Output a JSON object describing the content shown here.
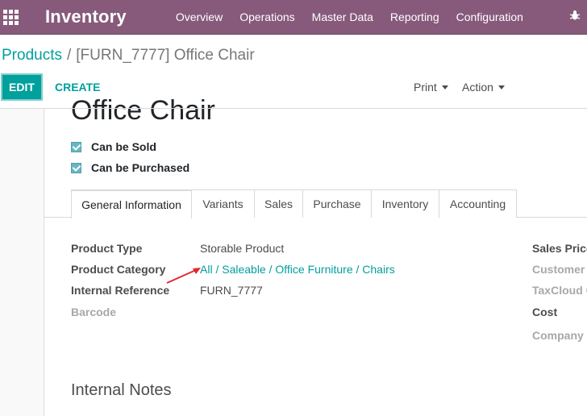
{
  "navbar": {
    "app_title": "Inventory",
    "menu": [
      "Overview",
      "Operations",
      "Master Data",
      "Reporting",
      "Configuration"
    ],
    "color": "#875a7b"
  },
  "breadcrumb": {
    "parent": "Products",
    "separator": "/",
    "current": "[FURN_7777] Office Chair"
  },
  "toolbar": {
    "edit_label": "EDIT",
    "create_label": "CREATE",
    "print_label": "Print",
    "action_label": "Action",
    "accent": "#00a09d"
  },
  "form": {
    "title": "Office Chair",
    "checkboxes": [
      {
        "label": "Can be Sold",
        "checked": true
      },
      {
        "label": "Can be Purchased",
        "checked": true
      }
    ],
    "tabs": [
      "General Information",
      "Variants",
      "Sales",
      "Purchase",
      "Inventory",
      "Accounting"
    ],
    "active_tab": "General Information",
    "left_fields": [
      {
        "label": "Product Type",
        "value": "Storable Product"
      },
      {
        "label": "Product Category",
        "value": "All / Saleable / Office Furniture / Chairs"
      },
      {
        "label": "Internal Reference",
        "value": "FURN_7777"
      },
      {
        "label": "Barcode",
        "value": ""
      }
    ],
    "right_fields": [
      {
        "label": "Sales Price"
      },
      {
        "label": "Customer T"
      },
      {
        "label": "TaxCloud C"
      },
      {
        "label": "Cost"
      },
      {
        "label": "Company"
      }
    ],
    "notes_heading": "Internal Notes"
  },
  "icons": {
    "apps": "apps-grid-icon",
    "debug": "bug-icon",
    "annotation": "red-arrow-icon"
  }
}
